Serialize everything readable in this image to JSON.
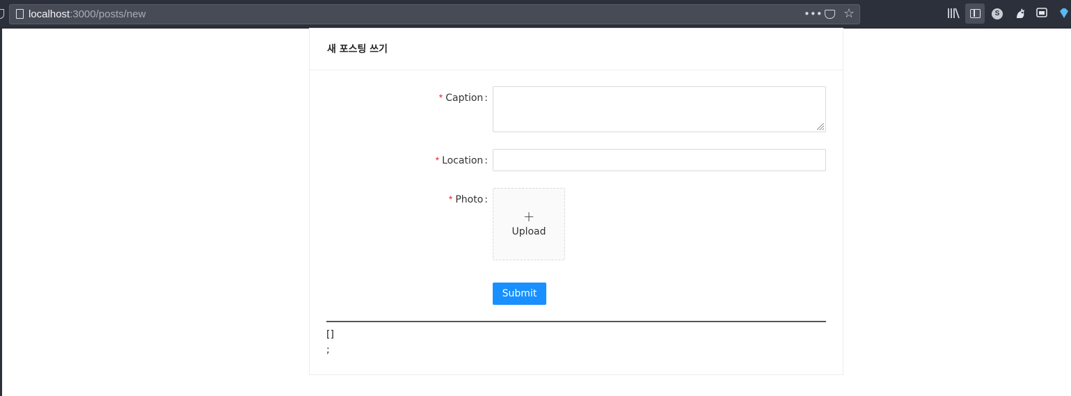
{
  "browser": {
    "url_host": "localhost",
    "url_rest": ":3000/posts/new",
    "more_glyph": "•••",
    "star_glyph": "☆"
  },
  "card": {
    "title": "새 포스팅 쓰기"
  },
  "form": {
    "required_mark": "*",
    "colon": ":",
    "caption_label": "Caption",
    "caption_value": "",
    "location_label": "Location",
    "location_value": "",
    "photo_label": "Photo",
    "upload_plus": "+",
    "upload_label": "Upload",
    "submit_label": "Submit"
  },
  "debug": {
    "line1": "[]",
    "line2": ";"
  },
  "colors": {
    "primary": "#1890ff",
    "required": "#f5222d",
    "chrome": "#2b303b"
  }
}
